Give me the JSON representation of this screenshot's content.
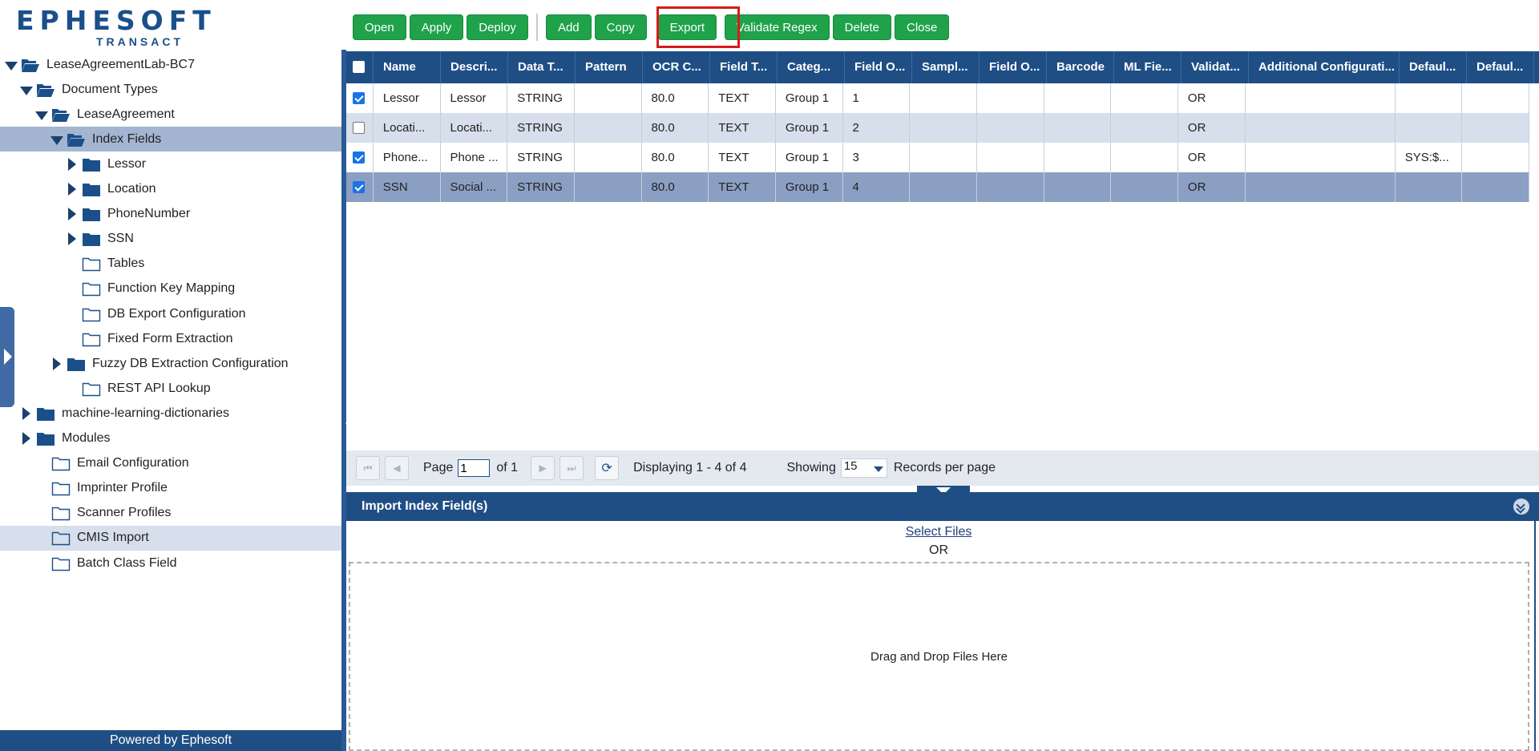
{
  "logo": {
    "word": "EPHESOFT",
    "sub": "TRANSACT"
  },
  "tree": [
    {
      "label": "LeaseAgreementLab-BC7",
      "indent": 0,
      "arrow": "down",
      "folder": "open"
    },
    {
      "label": "Document Types",
      "indent": 1,
      "arrow": "down",
      "folder": "open"
    },
    {
      "label": "LeaseAgreement",
      "indent": 2,
      "arrow": "down",
      "folder": "open"
    },
    {
      "label": "Index Fields",
      "indent": 3,
      "arrow": "down",
      "folder": "open",
      "state": "selected"
    },
    {
      "label": "Lessor",
      "indent": 4,
      "arrow": "right",
      "folder": "filled"
    },
    {
      "label": "Location",
      "indent": 4,
      "arrow": "right",
      "folder": "filled"
    },
    {
      "label": "PhoneNumber",
      "indent": 4,
      "arrow": "right",
      "folder": "filled"
    },
    {
      "label": "SSN",
      "indent": 4,
      "arrow": "right",
      "folder": "filled"
    },
    {
      "label": "Tables",
      "indent": 4,
      "arrow": "none",
      "folder": "outline"
    },
    {
      "label": "Function Key Mapping",
      "indent": 4,
      "arrow": "none",
      "folder": "outline"
    },
    {
      "label": "DB Export Configuration",
      "indent": 4,
      "arrow": "none",
      "folder": "outline"
    },
    {
      "label": "Fixed Form Extraction",
      "indent": 4,
      "arrow": "none",
      "folder": "outline"
    },
    {
      "label": "Fuzzy DB Extraction Configuration",
      "indent": 3,
      "arrow": "right",
      "folder": "filled"
    },
    {
      "label": "REST API Lookup",
      "indent": 4,
      "arrow": "none",
      "folder": "outline"
    },
    {
      "label": "machine-learning-dictionaries",
      "indent": 1,
      "arrow": "right",
      "folder": "filled"
    },
    {
      "label": "Modules",
      "indent": 1,
      "arrow": "right",
      "folder": "filled"
    },
    {
      "label": "Email Configuration",
      "indent": 2,
      "arrow": "none",
      "folder": "outline"
    },
    {
      "label": "Imprinter Profile",
      "indent": 2,
      "arrow": "none",
      "folder": "outline"
    },
    {
      "label": "Scanner Profiles",
      "indent": 2,
      "arrow": "none",
      "folder": "outline"
    },
    {
      "label": "CMIS Import",
      "indent": 2,
      "arrow": "none",
      "folder": "outline",
      "state": "hover"
    },
    {
      "label": "Batch Class Field",
      "indent": 2,
      "arrow": "none",
      "folder": "outline"
    }
  ],
  "footer": "Powered by Ephesoft",
  "toolbar": {
    "group1": [
      "Open",
      "Apply",
      "Deploy"
    ],
    "group2": [
      "Add",
      "Copy",
      "Export",
      "Validate Regex",
      "Delete",
      "Close"
    ]
  },
  "grid": {
    "columns": [
      {
        "label": "",
        "w": 34
      },
      {
        "label": "Name",
        "w": 84
      },
      {
        "label": "Descri...",
        "w": 84
      },
      {
        "label": "Data T...",
        "w": 84
      },
      {
        "label": "Pattern",
        "w": 84
      },
      {
        "label": "OCR C...",
        "w": 84
      },
      {
        "label": "Field T...",
        "w": 84
      },
      {
        "label": "Categ...",
        "w": 84
      },
      {
        "label": "Field O...",
        "w": 84
      },
      {
        "label": "Sampl...",
        "w": 84
      },
      {
        "label": "Field O...",
        "w": 84
      },
      {
        "label": "Barcode",
        "w": 84
      },
      {
        "label": "ML Fie...",
        "w": 84
      },
      {
        "label": "Validat...",
        "w": 84
      },
      {
        "label": "Additional Configurati...",
        "w": 188
      },
      {
        "label": "Defaul...",
        "w": 84
      },
      {
        "label": "Defaul...",
        "w": 84
      }
    ],
    "rows": [
      {
        "checked": true,
        "style": "",
        "cells": [
          "Lessor",
          "Lessor",
          "STRING",
          "",
          "80.0",
          "TEXT",
          "Group 1",
          "1",
          "",
          "",
          "",
          "",
          "OR",
          "",
          "",
          ""
        ]
      },
      {
        "checked": false,
        "style": "alt",
        "cells": [
          "Locati...",
          "Locati...",
          "STRING",
          "",
          "80.0",
          "TEXT",
          "Group 1",
          "2",
          "",
          "",
          "",
          "",
          "OR",
          "",
          "",
          ""
        ]
      },
      {
        "checked": true,
        "style": "",
        "cells": [
          "Phone...",
          "Phone ...",
          "STRING",
          "",
          "80.0",
          "TEXT",
          "Group 1",
          "3",
          "",
          "",
          "",
          "",
          "OR",
          "",
          "SYS:$...",
          ""
        ]
      },
      {
        "checked": true,
        "style": "sel",
        "cells": [
          "SSN",
          "Social ...",
          "STRING",
          "",
          "80.0",
          "TEXT",
          "Group 1",
          "4",
          "",
          "",
          "",
          "",
          "OR",
          "",
          "",
          ""
        ]
      }
    ]
  },
  "pager": {
    "page_label": "Page",
    "page_value": "1",
    "of_label": "of 1",
    "displaying": "Displaying 1 - 4 of 4",
    "showing_label": "Showing",
    "records_per_page": "15",
    "rpp_label": "Records per page"
  },
  "import": {
    "title": "Import Index Field(s)",
    "select_files": "Select Files",
    "or": "OR",
    "dropzone": "Drag and Drop Files Here"
  },
  "colors": {
    "accent": "#1f4e85",
    "button": "#1fa24a",
    "highlight": "#d51c1c"
  }
}
